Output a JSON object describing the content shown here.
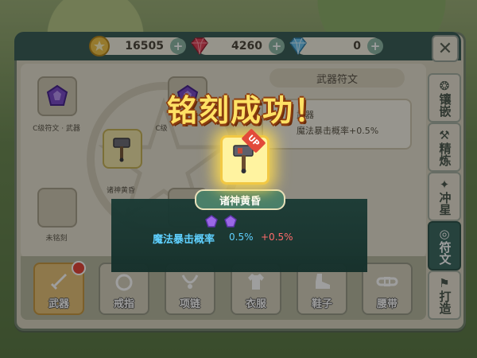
{
  "currency": {
    "gold": "16505",
    "gem_red": "4260",
    "gem_blue": "0",
    "plus_symbol": "+"
  },
  "close_symbol": "✕",
  "runes": {
    "slot1_label": "C级符文 · 武器",
    "slot2_label": "C级",
    "weapon_label": "诸神黄昏",
    "empty_label": "未铭刻"
  },
  "info_panel": {
    "title": "武器符文",
    "line1": "武器",
    "line2": "魔法暴击概率+0.5%"
  },
  "side_tabs": [
    {
      "label": "镶嵌",
      "glyph": "❂"
    },
    {
      "label": "精炼",
      "glyph": "⚒"
    },
    {
      "label": "冲星",
      "glyph": "✦"
    },
    {
      "label": "符文",
      "glyph": "◎"
    },
    {
      "label": "打造",
      "glyph": "⚑"
    }
  ],
  "equip_buttons": [
    {
      "label": "武器"
    },
    {
      "label": "戒指"
    },
    {
      "label": "项链"
    },
    {
      "label": "衣服"
    },
    {
      "label": "鞋子"
    },
    {
      "label": "腰带"
    }
  ],
  "popup": {
    "title": "铭刻成功！",
    "item_name": "诸神黄昏",
    "up_badge": "UP",
    "stat_name": "魔法暴击概率",
    "stat_value": "0.5%",
    "stat_bonus": "+0.5%"
  },
  "colors": {
    "accent_teal": "#3e6b63",
    "title_yellow": "#ffe265",
    "stat_blue": "#5fd0ff",
    "bonus_red": "#ff6b6b"
  }
}
